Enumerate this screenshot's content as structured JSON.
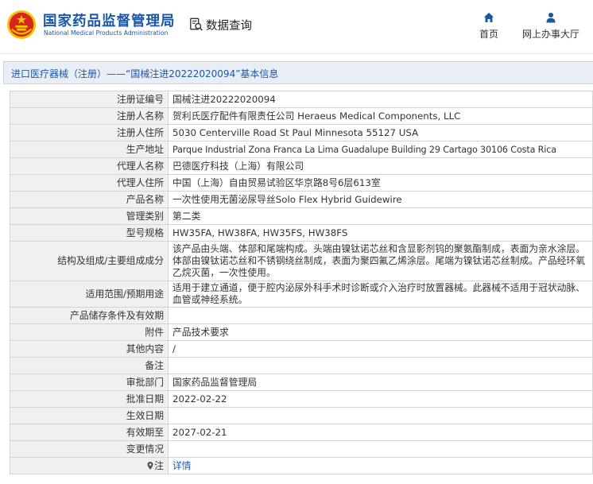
{
  "header": {
    "brand_cn": "国家药品监督管理局",
    "brand_en": "National Medical Products Administration",
    "query_label": "数据查询",
    "nav": [
      {
        "label": "首页",
        "icon": "home-icon"
      },
      {
        "label": "网上办事大厅",
        "icon": "user-icon"
      }
    ]
  },
  "breadcrumb": {
    "text": "进口医疗器械（注册）——“国械注进20222020094”基本信息"
  },
  "detail": {
    "rows": [
      {
        "label": "注册证编号",
        "value": "国械注进20222020094"
      },
      {
        "label": "注册人名称",
        "value": "贺利氏医疗配件有限责任公司 Heraeus Medical Components, LLC"
      },
      {
        "label": "注册人住所",
        "value": "5030 Centerville Road St Paul Minnesota 55127 USA"
      },
      {
        "label": "生产地址",
        "value": "Parque Industrial Zona Franca La Lima Guadalupe Building 29 Cartago 30106 Costa Rica"
      },
      {
        "label": "代理人名称",
        "value": "巴德医疗科技（上海）有限公司"
      },
      {
        "label": "代理人住所",
        "value": "中国（上海）自由贸易试验区华京路8号6层613室"
      },
      {
        "label": "产品名称",
        "value": "一次性使用无菌泌尿导丝Solo Flex Hybrid Guidewire"
      },
      {
        "label": "管理类别",
        "value": "第二类"
      },
      {
        "label": "型号规格",
        "value": "HW35FA, HW38FA, HW35FS, HW38FS"
      },
      {
        "label": "结构及组成/主要组成成分",
        "value": "该产品由头端、体部和尾端构成。头端由镍钛诺芯丝和含显影剂钨的聚氨酯制成，表面为亲水涂层。体部由镍钛诺芯丝和不锈钢绕丝制成，表面为聚四氟乙烯涂层。尾端为镍钛诺芯丝制成。产品经环氧乙烷灭菌，一次性使用。"
      },
      {
        "label": "适用范围/预期用途",
        "value": "适用于建立通道，便于腔内泌尿外科手术时诊断或介入治疗时放置器械。此器械不适用于冠状动脉、血管或神经系统。"
      },
      {
        "label": "产品储存条件及有效期",
        "value": ""
      },
      {
        "label": "附件",
        "value": "产品技术要求"
      },
      {
        "label": "其他内容",
        "value": "/"
      },
      {
        "label": "备注",
        "value": ""
      },
      {
        "label": "审批部门",
        "value": "国家药品监督管理局"
      },
      {
        "label": "批准日期",
        "value": "2022-02-22"
      },
      {
        "label": "生效日期",
        "value": ""
      },
      {
        "label": "有效期至",
        "value": "2027-02-21"
      },
      {
        "label": "变更情况",
        "value": ""
      }
    ],
    "note": {
      "label": "注",
      "link": "详情",
      "icon": "location-pin-icon"
    }
  },
  "colors": {
    "brand_blue": "#1a57a6",
    "emblem_red": "#d7261e",
    "emblem_gold": "#f5c400",
    "label_bg": "#f0f0f0",
    "crumb_bg": "#e9eef6"
  }
}
